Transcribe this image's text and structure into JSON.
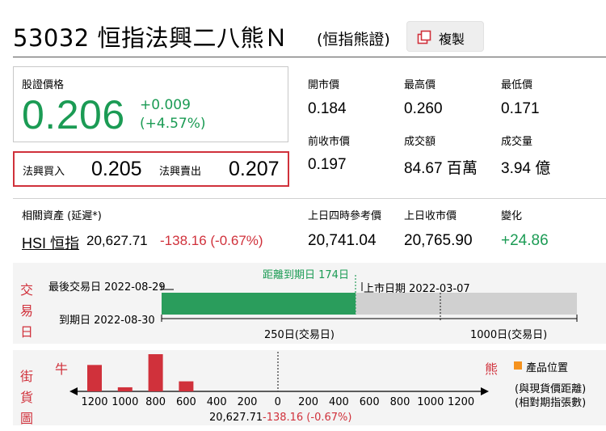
{
  "header": {
    "code_name": "53032 恒指法興二八熊Ｎ",
    "subtitle": "(恒指熊證)",
    "copy_label": "複製",
    "copy_icon": "copy-icon"
  },
  "price": {
    "label": "股證價格",
    "value": "0.206",
    "change": "+0.009",
    "change_pct": "(+4.57%)",
    "bid_label": "法興買入",
    "bid": "0.205",
    "ask_label": "法興賣出",
    "ask": "0.207"
  },
  "stats": {
    "open_label": "開市價",
    "open": "0.184",
    "high_label": "最高價",
    "high": "0.260",
    "low_label": "最低價",
    "low": "0.171",
    "prev_close_label": "前收市價",
    "prev_close": "0.197",
    "turnover_label": "成交額",
    "turnover": "84.67 百萬",
    "volume_label": "成交量",
    "volume": "3.94 億"
  },
  "underlying": {
    "label": "相關資產 (延遲*)",
    "name": "HSI 恒指",
    "price": "20,627.71",
    "change": "-138.16 (-0.67%)",
    "ref4pm_label": "上日四時參考價",
    "ref4pm": "20,741.04",
    "prev_close_label": "上日收市價",
    "prev_close": "20,765.90",
    "diff_label": "變化",
    "diff": "+24.86"
  },
  "trading_days": {
    "side_label": [
      "交",
      "易",
      "日"
    ],
    "last_trade_label": "最後交易日 2022-08-29",
    "expiry_label": "到期日 2022-08-30",
    "days_to_expiry_label": "距離到期日 174日",
    "listing_label": "上市日期 2022-03-07",
    "scale_250": "250日(交易日)",
    "scale_1000": "1000日(交易日)",
    "elapsed_fraction": 0.466,
    "color_fill": "#2a9d5c"
  },
  "street": {
    "side_label": [
      "街",
      "貨",
      "圖"
    ],
    "bull_label": "牛",
    "bear_label": "熊",
    "legend_label": "產品位置",
    "note1": "(與現貨價距離)",
    "note2": "(相對期指張數)",
    "axis_ticks": [
      "1200",
      "1000",
      "800",
      "600",
      "400",
      "200",
      "0",
      "200",
      "400",
      "600",
      "800",
      "1000",
      "1200"
    ],
    "bars": [
      {
        "position": "1200",
        "value": 0.71
      },
      {
        "position": "1000",
        "value": 0.11
      },
      {
        "position": "800",
        "value": 1.0
      },
      {
        "position": "600",
        "value": 0.27
      }
    ],
    "spot_label": "20,627.71",
    "spot_change": "-138.16 (-0.67%)",
    "color_bar": "#d0313b",
    "color_legend": "#f5921e"
  }
}
